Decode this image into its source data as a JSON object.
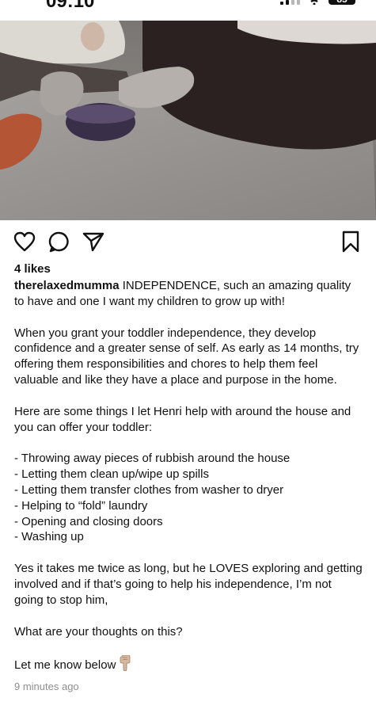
{
  "status_bar": {
    "time": "09:10",
    "battery": "85",
    "icons": [
      "signal-icon",
      "wifi-icon",
      "battery-icon"
    ]
  },
  "post": {
    "image_description_icons": [
      "toddler-legs",
      "bowl",
      "bowl"
    ],
    "actions": {
      "like": "heart-icon",
      "comment": "comment-icon",
      "share": "send-icon",
      "save": "bookmark-icon"
    },
    "likes": "4 likes",
    "caption": {
      "username": "therelaxedmumma",
      "intro": "INDEPENDENCE, such an amazing quality to have and one I want my children to grow up with!",
      "paragraph_1": "When you grant your toddler independence, they develop confidence and a greater sense of self. As early as 14 months, try offering them responsibilities and chores to help them feel valuable and like they have a place and purpose in the home.",
      "paragraph_2": "Here are some things I let Henri help with around the house and you can offer your toddler:",
      "list": [
        "- Throwing away pieces of rubbish around the house",
        "- Letting them clean up/wipe up spills",
        "- Letting them transfer clothes from washer to dryer",
        "- Helping to “fold” laundry",
        "- Opening and closing doors",
        "- Washing up"
      ],
      "paragraph_3": "Yes it takes me twice as long, but he LOVES exploring and getting involved and if that’s going to help his independence, I’m not going to stop him,",
      "paragraph_4": "What are your thoughts on this?",
      "paragraph_5": "Let me know below"
    },
    "timestamp": "9 minutes ago"
  },
  "colors": {
    "text": "#111111",
    "muted": "#8e8e8e",
    "background": "#ffffff"
  }
}
